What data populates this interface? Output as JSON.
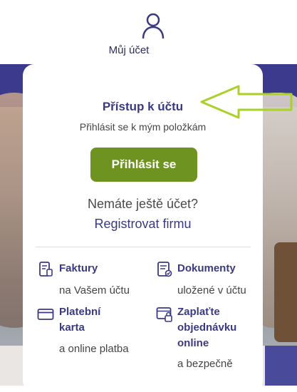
{
  "account": {
    "label": "Můj účet",
    "icon": "user-icon"
  },
  "card": {
    "title": "Přístup k účtu",
    "subtitle": "Přihlásit se k mým položkám",
    "login_button": "Přihlásit se",
    "no_account": "Nemáte ještě účet?",
    "register_link": "Registrovat firmu"
  },
  "features": [
    {
      "icon": "invoice-icon",
      "title": "Faktury",
      "subtitle": "na Vašem účtu"
    },
    {
      "icon": "documents-icon",
      "title": "Dokumenty",
      "subtitle": "uložené v účtu"
    },
    {
      "icon": "payment-card-icon",
      "title_line1": "Platební",
      "title_line2": "karta",
      "subtitle": "a online platba"
    },
    {
      "icon": "secure-order-icon",
      "title_line1": "Zaplaťte",
      "title_line2": "objednávku",
      "title_line3": "online",
      "subtitle": "a bezpečně"
    }
  ],
  "colors": {
    "brand": "#3a3a82",
    "button": "#6e9320",
    "arrow": "#a9d12a"
  }
}
